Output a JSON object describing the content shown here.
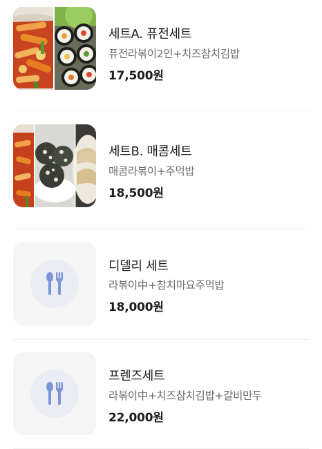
{
  "menu_items": [
    {
      "name": "세트A. 퓨전세트",
      "description": "퓨전라볶이2인+치즈참치김밥",
      "price": "17,500원",
      "image": "tteokbokki-kimbap-photo"
    },
    {
      "name": "세트B. 매콤세트",
      "description": "매콤라볶이+주먹밥",
      "price": "18,500원",
      "image": "tteokbokki-riceball-dumpling-photo"
    },
    {
      "name": "디델리 세트",
      "description": "라볶이中+참치마요주먹밥",
      "price": "18,000원",
      "image": "fork-spoon-icon"
    },
    {
      "name": "프렌즈세트",
      "description": "라볶이中+치즈참치김밥+갈비만두",
      "price": "22,000원",
      "image": "fork-spoon-icon"
    }
  ],
  "colors": {
    "placeholder_bg": "#f5f5f6",
    "placeholder_circle": "#eaedf3",
    "utensil_icon": "#7c95d6"
  }
}
